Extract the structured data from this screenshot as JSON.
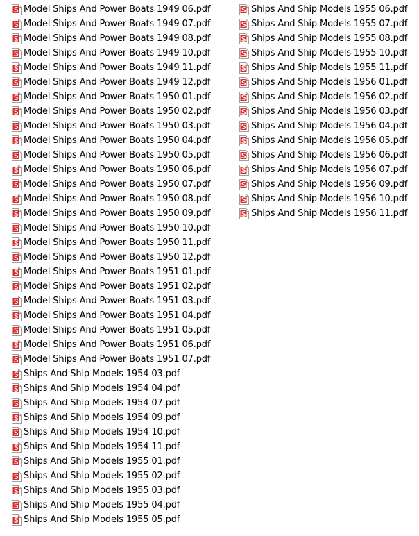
{
  "icon": "pdf-file-icon",
  "colors": {
    "icon_red": "#d32f2f",
    "icon_border": "#9e9e9e",
    "text": "#000000"
  },
  "columns": [
    {
      "files": [
        "Model Ships And Power Boats 1949 06.pdf",
        "Model Ships And Power Boats 1949 07.pdf",
        "Model Ships And Power Boats 1949 08.pdf",
        "Model Ships And Power Boats 1949 10.pdf",
        "Model Ships And Power Boats 1949 11.pdf",
        "Model Ships And Power Boats 1949 12.pdf",
        "Model Ships And Power Boats 1950 01.pdf",
        "Model Ships And Power Boats 1950 02.pdf",
        "Model Ships And Power Boats 1950 03.pdf",
        "Model Ships And Power Boats 1950 04.pdf",
        "Model Ships And Power Boats 1950 05.pdf",
        "Model Ships And Power Boats 1950 06.pdf",
        "Model Ships And Power Boats 1950 07.pdf",
        "Model Ships And Power Boats 1950 08.pdf",
        "Model Ships And Power Boats 1950 09.pdf",
        "Model Ships And Power Boats 1950 10.pdf",
        "Model Ships And Power Boats 1950 11.pdf",
        "Model Ships And Power Boats 1950 12.pdf",
        "Model Ships And Power Boats 1951 01.pdf",
        "Model Ships And Power Boats 1951 02.pdf",
        "Model Ships And Power Boats 1951 03.pdf",
        "Model Ships And Power Boats 1951 04.pdf",
        "Model Ships And Power Boats 1951 05.pdf",
        "Model Ships And Power Boats 1951 06.pdf",
        "Model Ships And Power Boats 1951 07.pdf",
        "Ships And Ship Models 1954 03.pdf",
        "Ships And Ship Models 1954 04.pdf",
        "Ships And Ship Models 1954 07.pdf",
        "Ships And Ship Models 1954 09.pdf",
        "Ships And Ship Models 1954 10.pdf",
        "Ships And Ship Models 1954 11.pdf",
        "Ships And Ship Models 1955 01.pdf",
        "Ships And Ship Models 1955 02.pdf",
        "Ships And Ship Models 1955 03.pdf",
        "Ships And Ship Models 1955 04.pdf",
        "Ships And Ship Models 1955 05.pdf"
      ]
    },
    {
      "files": [
        "Ships And Ship Models 1955 06.pdf",
        "Ships And Ship Models 1955 07.pdf",
        "Ships And Ship Models 1955 08.pdf",
        "Ships And Ship Models 1955 10.pdf",
        "Ships And Ship Models 1955 11.pdf",
        "Ships And Ship Models 1956 01.pdf",
        "Ships And Ship Models 1956 02.pdf",
        "Ships And Ship Models 1956 03.pdf",
        "Ships And Ship Models 1956 04.pdf",
        "Ships And Ship Models 1956 05.pdf",
        "Ships And Ship Models 1956 06.pdf",
        "Ships And Ship Models 1956 07.pdf",
        "Ships And Ship Models 1956 09.pdf",
        "Ships And Ship Models 1956 10.pdf",
        "Ships And Ship Models 1956 11.pdf"
      ]
    }
  ]
}
